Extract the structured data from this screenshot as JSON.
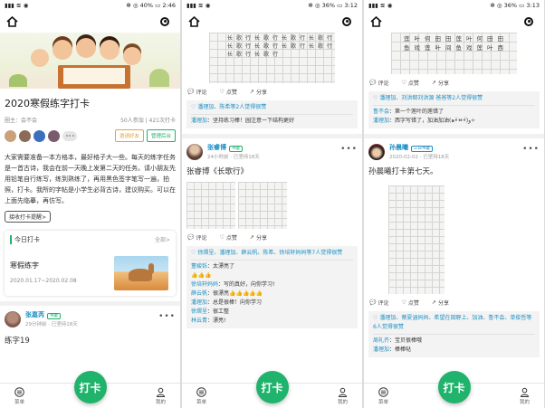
{
  "status": [
    {
      "battery": "40%",
      "time": "2:46"
    },
    {
      "battery": "36%",
      "time": "3:12"
    },
    {
      "battery": "36%",
      "time": "3:13"
    }
  ],
  "tabbar": {
    "menu_label": "菜单",
    "checkin_label": "打卡",
    "mine_label": "我的"
  },
  "s1": {
    "title": "2020寒假练字打卡",
    "owner_label": "圈主：",
    "owner": "会不会",
    "stats": "50人参加 | 421次打卡",
    "invite_label": "邀请好友",
    "admin_label": "管理后台",
    "description": "大家需要准备一本方格本，最好格子大一些。每天的练字任务是一首古诗，我会在前一天晚上发第二天的任务。请小朋友先用铅笔自行练写，练到熟练了，再用黑色签字笔写一遍，拍照，打卡。我所的字帖是小学生必背古诗，建议购买。可以在上面先临摹，再仿写。",
    "reminder_label": "接收打卡提醒>",
    "today_label": "今日打卡",
    "all_label": "全部>",
    "task_title": "寒假练字",
    "task_dates": "2020.01.17~2020.02.08",
    "post": {
      "name": "张嘉芮",
      "badge": "书童",
      "time": "29分钟前",
      "streak": "已坚持18天",
      "text": "练字19"
    }
  },
  "s2": {
    "actions": {
      "comment": "评论",
      "like": "点赞",
      "share": "分享"
    },
    "post1": {
      "likes": "潘理加、陈希等2人觉得很赞",
      "comments": [
        {
          "user": "潘理加",
          "text": "：坚持练习棒！园注意一下结构更好"
        }
      ]
    },
    "post2": {
      "name": "张睿博",
      "badge": "书童",
      "time": "24小时前",
      "streak": "已坚持18天",
      "text": "张睿博《长歌行》",
      "likes": "徐熠呈、潘理加、薛云帆、陈希、徐培轩妈妈等7人觉得很赞",
      "comments": [
        {
          "user": "董峻铄",
          "text": "：太漂亮了"
        },
        {
          "user": "",
          "text": "👍👍👍"
        },
        {
          "user": "徐培轩妈妈",
          "text": "：写的真好，向你学习!"
        },
        {
          "user": "薛云帆",
          "text": "：很漂亮👍👍👍👍👍"
        },
        {
          "user": "潘理加",
          "text": "：总是很棒！向你学习"
        },
        {
          "user": "徐熠呈",
          "text": "：很工整"
        },
        {
          "user": "林云青",
          "text": "：漂亮!"
        }
      ]
    }
  },
  "s3": {
    "actions": {
      "comment": "评论",
      "like": "点赞",
      "share": "分享"
    },
    "post1": {
      "likes": "潘理加、刘洪郗刘洪源 爸爸等2人觉得很赞",
      "comments": [
        {
          "user": "鲁不会",
          "text": "：第一个莲叶的莲错了"
        },
        {
          "user": "潘理加",
          "text": "：西字写错了，加油加油(๑•̀ㅂ•́)و✧"
        }
      ]
    },
    "post2": {
      "name": "孙晨曦",
      "badge": "三日书童",
      "time": "2020-02-02",
      "streak": "已坚持18天",
      "text": "孙晨曦打卡第七天。",
      "likes": "潘理加、蔡夏涵妈妈、希望在田野上、加油、鲁不会、单俊哲等6人觉得很赞",
      "comments": [
        {
          "user": "周礼齐",
          "text": "：宝贝很棒哦"
        },
        {
          "user": "潘理加",
          "text": "：棒棒哒"
        }
      ]
    }
  },
  "colors": {
    "accent": "#1fb36c",
    "link": "#1c8fc2",
    "invite": "#e6a23c"
  }
}
